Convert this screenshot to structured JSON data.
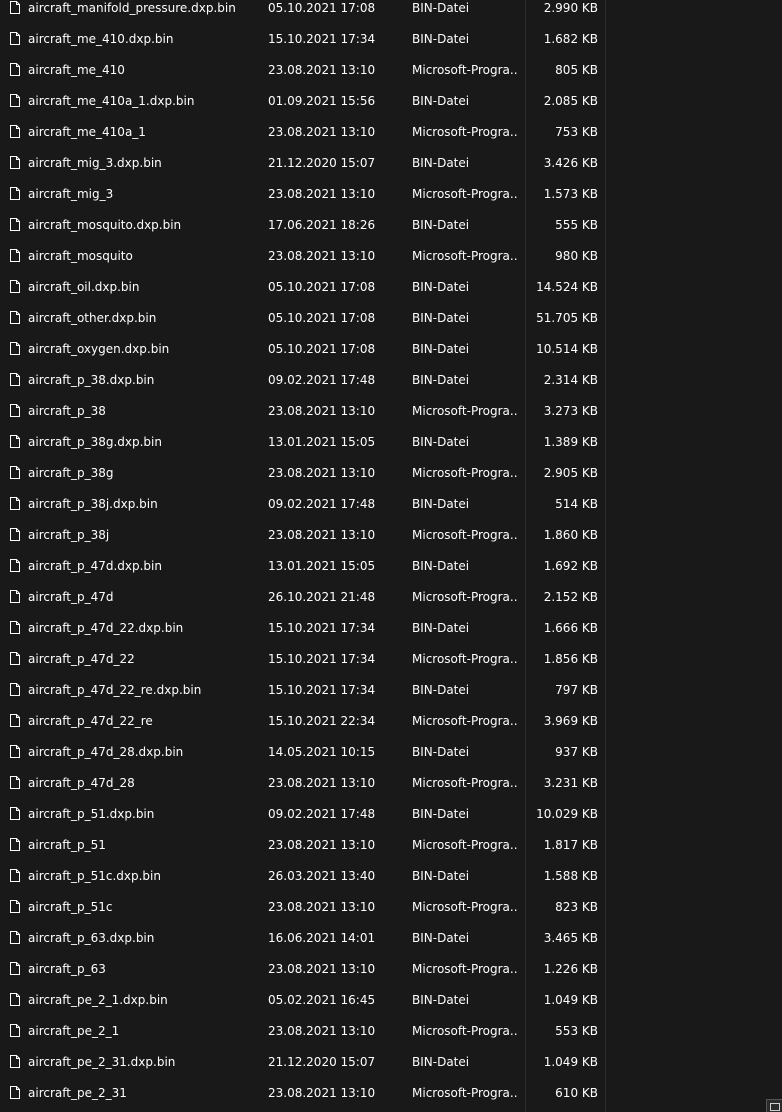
{
  "icons": {
    "file": "file-icon",
    "corner": "window-resize-icon"
  },
  "colors": {
    "background": "#191919",
    "text": "#ffffff"
  },
  "files": [
    {
      "name": "aircraft_manifold_pressure.dxp.bin",
      "date": "05.10.2021 17:08",
      "type": "BIN-Datei",
      "size": "2.990 KB"
    },
    {
      "name": "aircraft_me_410.dxp.bin",
      "date": "15.10.2021 17:34",
      "type": "BIN-Datei",
      "size": "1.682 KB"
    },
    {
      "name": "aircraft_me_410",
      "date": "23.08.2021 13:10",
      "type": "Microsoft-Progra...",
      "size": "805 KB"
    },
    {
      "name": "aircraft_me_410a_1.dxp.bin",
      "date": "01.09.2021 15:56",
      "type": "BIN-Datei",
      "size": "2.085 KB"
    },
    {
      "name": "aircraft_me_410a_1",
      "date": "23.08.2021 13:10",
      "type": "Microsoft-Progra...",
      "size": "753 KB"
    },
    {
      "name": "aircraft_mig_3.dxp.bin",
      "date": "21.12.2020 15:07",
      "type": "BIN-Datei",
      "size": "3.426 KB"
    },
    {
      "name": "aircraft_mig_3",
      "date": "23.08.2021 13:10",
      "type": "Microsoft-Progra...",
      "size": "1.573 KB"
    },
    {
      "name": "aircraft_mosquito.dxp.bin",
      "date": "17.06.2021 18:26",
      "type": "BIN-Datei",
      "size": "555 KB"
    },
    {
      "name": "aircraft_mosquito",
      "date": "23.08.2021 13:10",
      "type": "Microsoft-Progra...",
      "size": "980 KB"
    },
    {
      "name": "aircraft_oil.dxp.bin",
      "date": "05.10.2021 17:08",
      "type": "BIN-Datei",
      "size": "14.524 KB"
    },
    {
      "name": "aircraft_other.dxp.bin",
      "date": "05.10.2021 17:08",
      "type": "BIN-Datei",
      "size": "51.705 KB"
    },
    {
      "name": "aircraft_oxygen.dxp.bin",
      "date": "05.10.2021 17:08",
      "type": "BIN-Datei",
      "size": "10.514 KB"
    },
    {
      "name": "aircraft_p_38.dxp.bin",
      "date": "09.02.2021 17:48",
      "type": "BIN-Datei",
      "size": "2.314 KB"
    },
    {
      "name": "aircraft_p_38",
      "date": "23.08.2021 13:10",
      "type": "Microsoft-Progra...",
      "size": "3.273 KB"
    },
    {
      "name": "aircraft_p_38g.dxp.bin",
      "date": "13.01.2021 15:05",
      "type": "BIN-Datei",
      "size": "1.389 KB"
    },
    {
      "name": "aircraft_p_38g",
      "date": "23.08.2021 13:10",
      "type": "Microsoft-Progra...",
      "size": "2.905 KB"
    },
    {
      "name": "aircraft_p_38j.dxp.bin",
      "date": "09.02.2021 17:48",
      "type": "BIN-Datei",
      "size": "514 KB"
    },
    {
      "name": "aircraft_p_38j",
      "date": "23.08.2021 13:10",
      "type": "Microsoft-Progra...",
      "size": "1.860 KB"
    },
    {
      "name": "aircraft_p_47d.dxp.bin",
      "date": "13.01.2021 15:05",
      "type": "BIN-Datei",
      "size": "1.692 KB"
    },
    {
      "name": "aircraft_p_47d",
      "date": "26.10.2021 21:48",
      "type": "Microsoft-Progra...",
      "size": "2.152 KB"
    },
    {
      "name": "aircraft_p_47d_22.dxp.bin",
      "date": "15.10.2021 17:34",
      "type": "BIN-Datei",
      "size": "1.666 KB"
    },
    {
      "name": "aircraft_p_47d_22",
      "date": "15.10.2021 17:34",
      "type": "Microsoft-Progra...",
      "size": "1.856 KB"
    },
    {
      "name": "aircraft_p_47d_22_re.dxp.bin",
      "date": "15.10.2021 17:34",
      "type": "BIN-Datei",
      "size": "797 KB"
    },
    {
      "name": "aircraft_p_47d_22_re",
      "date": "15.10.2021 22:34",
      "type": "Microsoft-Progra...",
      "size": "3.969 KB"
    },
    {
      "name": "aircraft_p_47d_28.dxp.bin",
      "date": "14.05.2021 10:15",
      "type": "BIN-Datei",
      "size": "937 KB"
    },
    {
      "name": "aircraft_p_47d_28",
      "date": "23.08.2021 13:10",
      "type": "Microsoft-Progra...",
      "size": "3.231 KB"
    },
    {
      "name": "aircraft_p_51.dxp.bin",
      "date": "09.02.2021 17:48",
      "type": "BIN-Datei",
      "size": "10.029 KB"
    },
    {
      "name": "aircraft_p_51",
      "date": "23.08.2021 13:10",
      "type": "Microsoft-Progra...",
      "size": "1.817 KB"
    },
    {
      "name": "aircraft_p_51c.dxp.bin",
      "date": "26.03.2021 13:40",
      "type": "BIN-Datei",
      "size": "1.588 KB"
    },
    {
      "name": "aircraft_p_51c",
      "date": "23.08.2021 13:10",
      "type": "Microsoft-Progra...",
      "size": "823 KB"
    },
    {
      "name": "aircraft_p_63.dxp.bin",
      "date": "16.06.2021 14:01",
      "type": "BIN-Datei",
      "size": "3.465 KB"
    },
    {
      "name": "aircraft_p_63",
      "date": "23.08.2021 13:10",
      "type": "Microsoft-Progra...",
      "size": "1.226 KB"
    },
    {
      "name": "aircraft_pe_2_1.dxp.bin",
      "date": "05.02.2021 16:45",
      "type": "BIN-Datei",
      "size": "1.049 KB"
    },
    {
      "name": "aircraft_pe_2_1",
      "date": "23.08.2021 13:10",
      "type": "Microsoft-Progra...",
      "size": "553 KB"
    },
    {
      "name": "aircraft_pe_2_31.dxp.bin",
      "date": "21.12.2020 15:07",
      "type": "BIN-Datei",
      "size": "1.049 KB"
    },
    {
      "name": "aircraft_pe_2_31",
      "date": "23.08.2021 13:10",
      "type": "Microsoft-Progra...",
      "size": "610 KB"
    }
  ]
}
